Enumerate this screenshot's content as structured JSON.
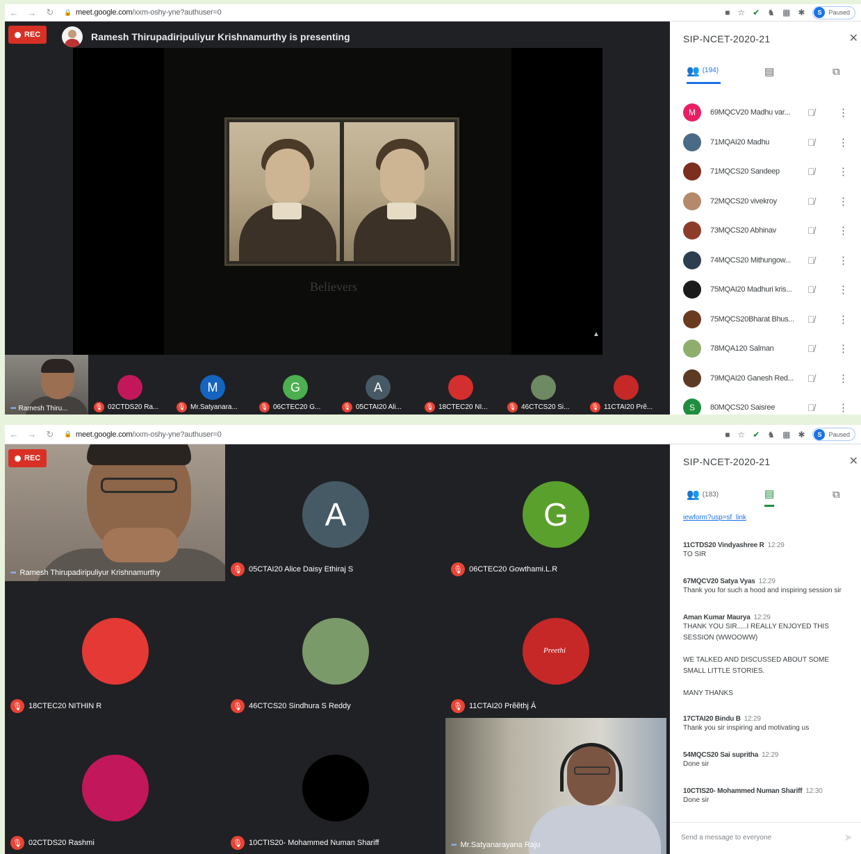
{
  "top": {
    "url_host": "meet.google.com",
    "url_path": "/xxm-oshy-yne?authuser=0",
    "profile_initial": "S",
    "profile_status": "Paused",
    "rec_label": "REC",
    "presenting_text": "Ramesh Thirupadiripuliyur Krishnamurthy is presenting",
    "slide_caption": "Believers",
    "strip": {
      "self_label": "Ramesh Thiru...",
      "tiles": [
        {
          "label": "02CTDS20 Ra...",
          "initial": "",
          "color": "#c2185b"
        },
        {
          "label": "Mr.Satyanara...",
          "initial": "M",
          "color": "#1565c0"
        },
        {
          "label": "06CTEC20 G...",
          "initial": "G",
          "color": "#4caf50"
        },
        {
          "label": "05CTAI20 Ali...",
          "initial": "A",
          "color": "#455a64"
        },
        {
          "label": "18CTEC20 NI...",
          "initial": "",
          "color": "#d32f2f"
        },
        {
          "label": "46CTCS20 Si...",
          "initial": "",
          "color": "#6d8a63"
        },
        {
          "label": "11CTAI20 Prẽ...",
          "initial": "",
          "color": "#c62828"
        }
      ]
    },
    "side": {
      "title": "SIP-NCET-2020-21",
      "people_count": "(194)",
      "participants": [
        {
          "name": "69MQCV20 Madhu var...",
          "initial": "M",
          "color": "#e91e63"
        },
        {
          "name": "71MQAI20 Madhu",
          "initial": "",
          "color": "#4a6a85"
        },
        {
          "name": "71MQCS20 Sandeep",
          "initial": "",
          "color": "#7b2f1f"
        },
        {
          "name": "72MQCS20 vivekroy",
          "initial": "",
          "color": "#b58a6c"
        },
        {
          "name": "73MQCS20 Abhinav",
          "initial": "",
          "color": "#8d3c2a"
        },
        {
          "name": "74MQCS20 Mithungow...",
          "initial": "",
          "color": "#2c3e50"
        },
        {
          "name": "75MQAI20 Madhuri kris...",
          "initial": "",
          "color": "#1b1b1b"
        },
        {
          "name": "75MQCS20Bharat Bhus...",
          "initial": "",
          "color": "#6b3b1f"
        },
        {
          "name": "78MQA120 Salman",
          "initial": "",
          "color": "#8fae6e"
        },
        {
          "name": "79MQAI20 Ganesh Red...",
          "initial": "",
          "color": "#5d3a23"
        },
        {
          "name": "80MQCS20 Saisree",
          "initial": "S",
          "color": "#1e8e3e"
        }
      ]
    }
  },
  "bottom": {
    "url_host": "meet.google.com",
    "url_path": "/xxm-oshy-yne?authuser=0",
    "profile_initial": "S",
    "profile_status": "Paused",
    "rec_label": "REC",
    "tiles": [
      {
        "label": "Ramesh Thirupadiripuliyur Krishnamurthy"
      },
      {
        "label": "05CTAI20 Alice Daisy Ethiraj S",
        "initial": "A",
        "color": "#455a64"
      },
      {
        "label": "06CTEC20 Gowthami.L.R",
        "initial": "G",
        "color": "#5aa02c"
      },
      {
        "label": "18CTEC20 NITHIN R",
        "initial": "",
        "color": "#e53935"
      },
      {
        "label": "46CTCS20 Sindhura S Reddy",
        "initial": "",
        "color": "#7a9a6a"
      },
      {
        "label": "11CTAI20 Prẽẽthj Á",
        "initial": "",
        "color": "#c62828",
        "inner_text": "Preethi"
      },
      {
        "label": "02CTDS20 Rashmi",
        "initial": "",
        "color": "#c2185b"
      },
      {
        "label": "10CTIS20- Mohammed Numan Shariff",
        "initial": "",
        "color": "#000000"
      },
      {
        "label": "Mr.Satyanarayana Raju"
      }
    ],
    "side": {
      "title": "SIP-NCET-2020-21",
      "people_count": "(183)",
      "link_text": "iewform?usp=sf_link",
      "messages": [
        {
          "who": "11CTDS20 Vindyashree R",
          "time": "12:29",
          "text": [
            "TO SIR"
          ]
        },
        {
          "who": "67MQCV20 Satya Vyas",
          "time": "12:29",
          "text": [
            "Thank you for such a hood and inspiring session sir"
          ]
        },
        {
          "who": "Aman Kumar Maurya",
          "time": "12:29",
          "text": [
            "THANK YOU SIR.....I REALLY ENJOYED THIS",
            "SESSION (WWOOWW)",
            "",
            "WE TALKED AND DISCUSSED ABOUT SOME",
            "SMALL LITTLE STORIES.",
            "",
            "MANY THANKS"
          ]
        },
        {
          "who": "17CTAI20 Bindu B",
          "time": "12:29",
          "text": [
            "Thank you sir inspiring and motivating us"
          ]
        },
        {
          "who": "54MQCS20 Sai supritha",
          "time": "12:29",
          "text": [
            "Done sir"
          ]
        },
        {
          "who": "10CTIS20- Mohammed Numan Shariff",
          "time": "12:30",
          "text": [
            "Done sir"
          ]
        }
      ],
      "input_placeholder": "Send a message to everyone"
    }
  }
}
